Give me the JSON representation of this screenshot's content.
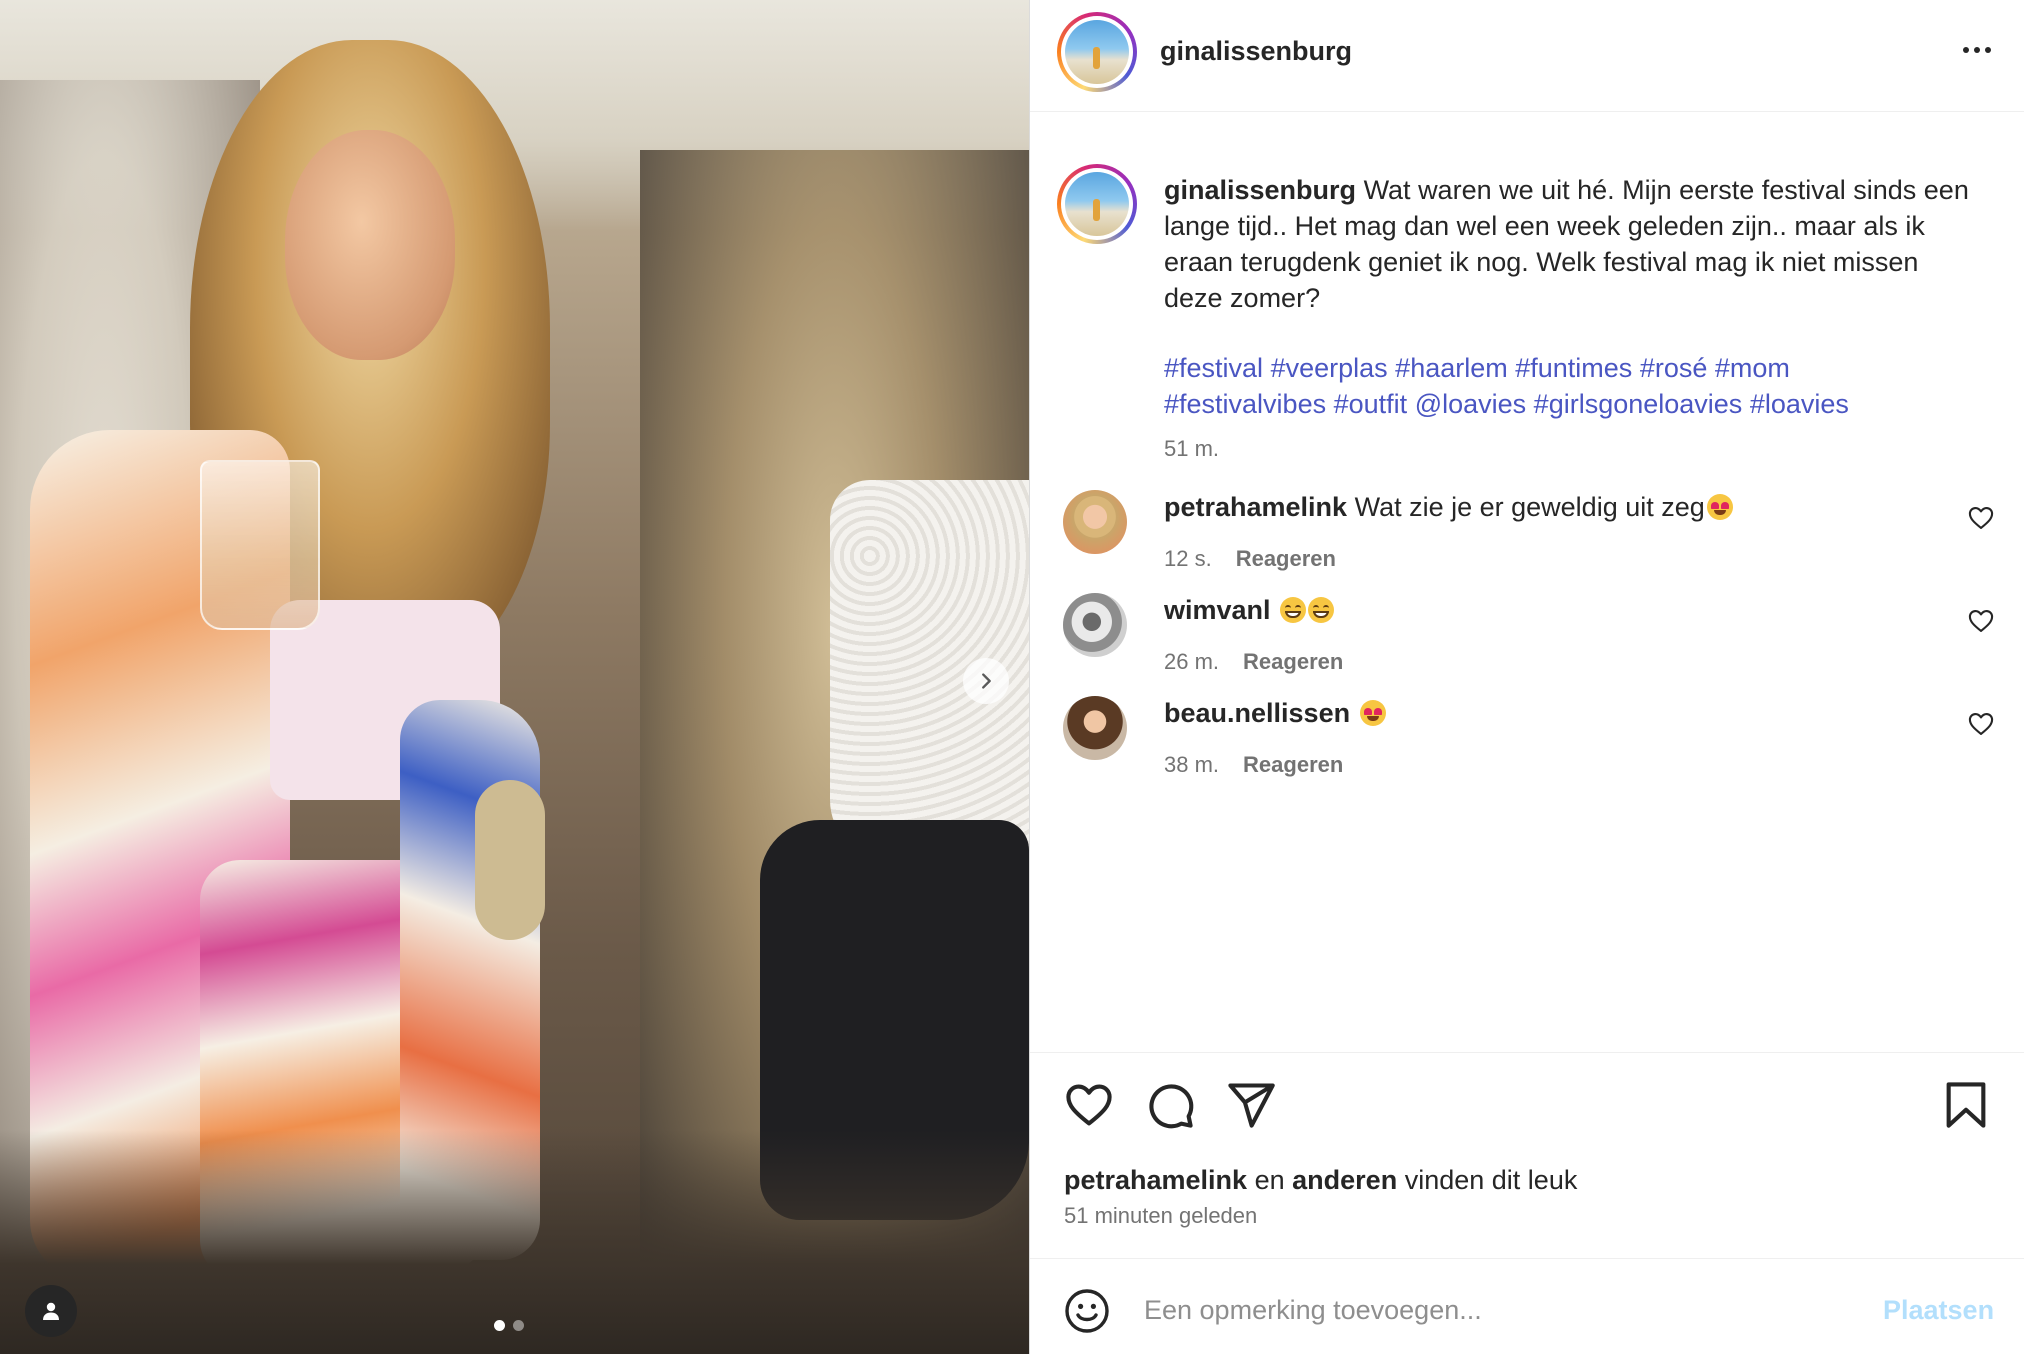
{
  "post": {
    "username": "ginalissenburg",
    "caption_text": "Wat waren we uit hé. Mijn eerste festival sinds een lange tijd.. Het mag dan wel een week geleden zijn.. maar als ik eraan terugdenk geniet ik nog. Welk festival mag ik niet missen deze zomer?",
    "hashtags": [
      "#festival",
      "#veerplas",
      "#haarlem",
      "#funtimes",
      "#rosé",
      "#mom",
      "#festivalvibes",
      "#outfit",
      "@loavies",
      "#girlsgoneloavies",
      "#loavies"
    ],
    "caption_time": "51 m."
  },
  "media": {
    "carousel_count": 2,
    "active_index": 1,
    "next_icon": "chevron-right-icon",
    "tags_icon": "user-icon"
  },
  "comments": [
    {
      "username": "petrahamelink",
      "text": "Wat zie je er geweldig uit zeg",
      "emoji": [
        "love"
      ],
      "time": "12 s.",
      "reply_label": "Reageren"
    },
    {
      "username": "wimvanl",
      "text": "",
      "emoji": [
        "grin",
        "grin"
      ],
      "time": "26 m.",
      "reply_label": "Reageren"
    },
    {
      "username": "beau.nellissen",
      "text": "",
      "emoji": [
        "love"
      ],
      "time": "38 m.",
      "reply_label": "Reageren"
    }
  ],
  "likes": {
    "first_user": "petrahamelink",
    "connector": "en",
    "others": "anderen",
    "suffix": "vinden dit leuk",
    "posted_ago": "51 minuten geleden"
  },
  "composer": {
    "placeholder": "Een opmerking toevoegen...",
    "post_label": "Plaatsen"
  },
  "icons": {
    "more": "more-horizontal-icon",
    "like": "heart-icon",
    "comment": "comment-icon",
    "share": "send-icon",
    "save": "bookmark-icon",
    "emoji": "smiley-icon"
  },
  "colors": {
    "hashtag": "#4a56c2",
    "post_button_disabled": "#b2dffc",
    "muted_text": "#737373"
  }
}
